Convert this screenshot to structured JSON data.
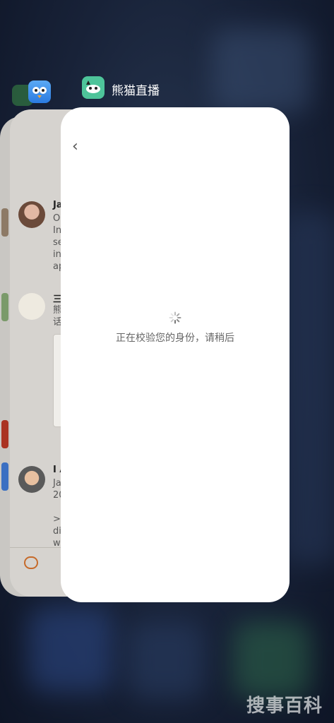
{
  "app_switcher": {
    "active_app_title": "熊猫直播",
    "front_card": {
      "back_label": "‹",
      "loading_text": "正在校验您的身份，请稍后"
    },
    "tweetbot_card": {
      "rows": [
        {
          "name": "Ja",
          "lines": [
            "O",
            "In",
            "se",
            "in",
            "ap"
          ]
        },
        {
          "name": "三",
          "lines": [
            "熊",
            "话"
          ]
        },
        {
          "name": "I A",
          "lines": [
            "Ja",
            "20",
            "",
            ">",
            "di",
            "w"
          ]
        }
      ]
    },
    "watermark": "搜事百科"
  }
}
